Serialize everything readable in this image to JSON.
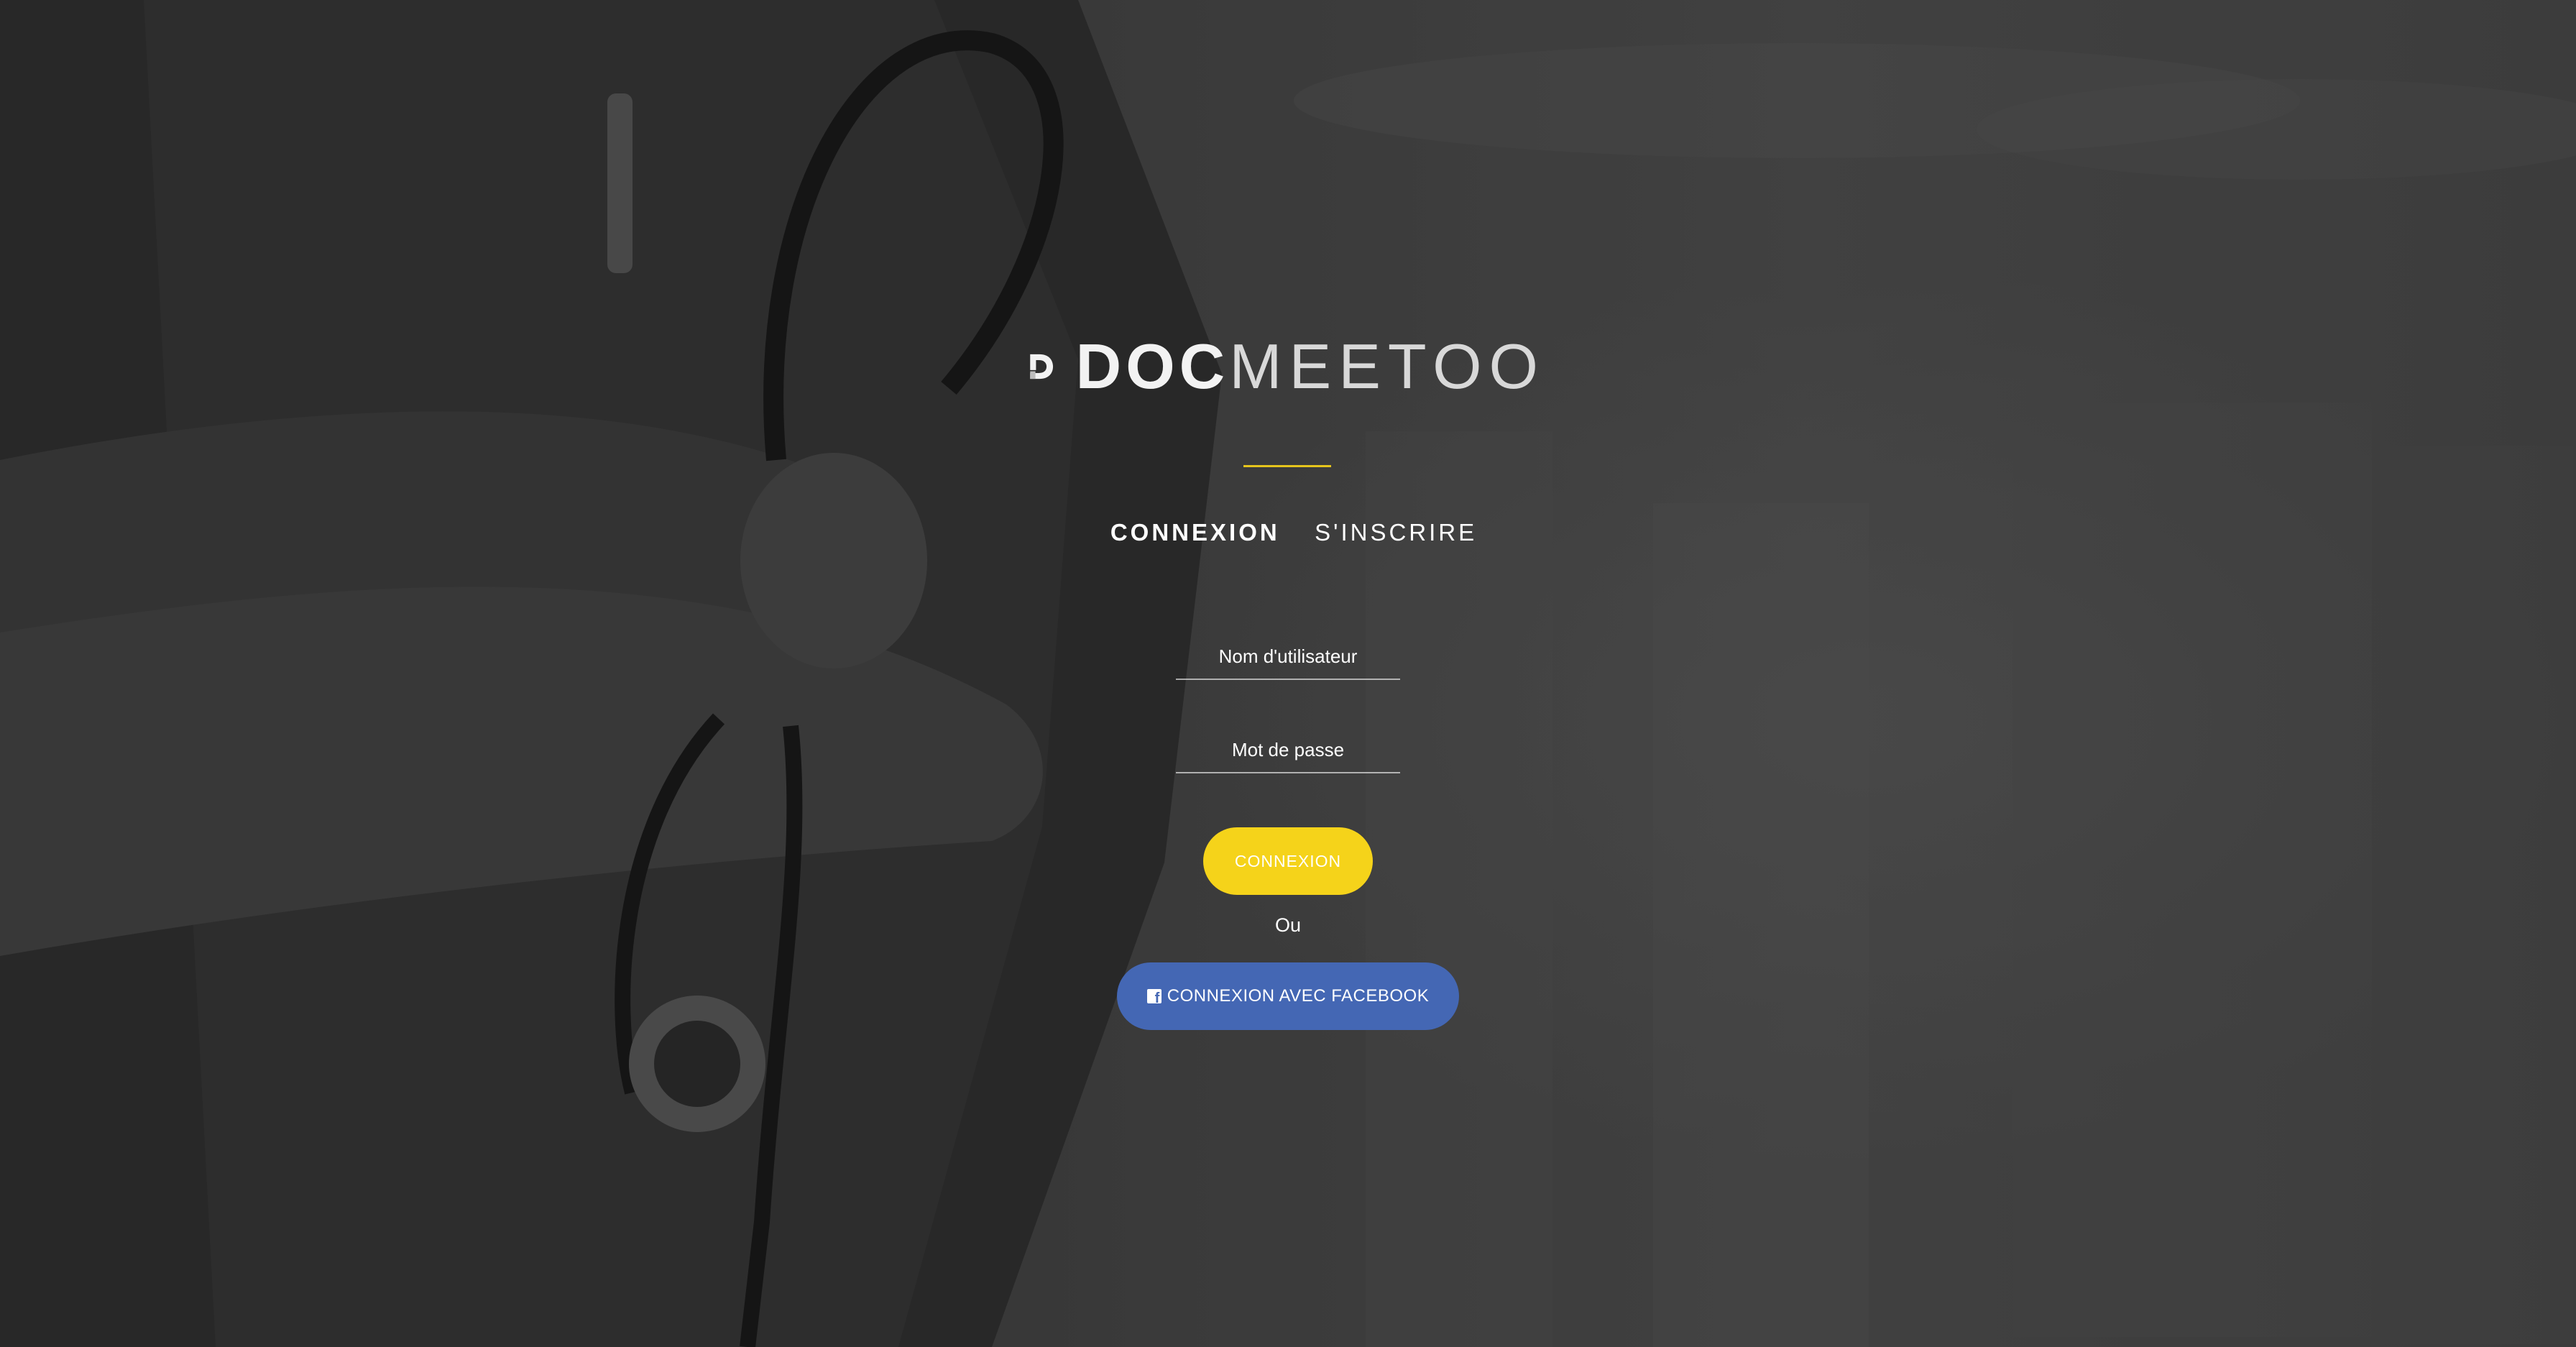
{
  "app": {
    "logo": {
      "bold_part": "DOC",
      "light_part": "MEETOO"
    }
  },
  "auth": {
    "tabs": [
      {
        "label": "CONNEXION",
        "active": true
      },
      {
        "label": "S'INSCRIRE",
        "active": false
      }
    ],
    "username": {
      "placeholder": "Nom d'utilisateur",
      "value": ""
    },
    "password": {
      "placeholder": "Mot de passe",
      "value": ""
    },
    "login_button": "CONNEXION",
    "or_text": "Ou",
    "facebook_button": "CONNEXION AVEC FACEBOOK"
  },
  "icons": {
    "logo_mark": "d-logo-icon",
    "facebook": "facebook-icon"
  },
  "colors": {
    "accent_yellow": "#f5d31a",
    "divider_yellow": "#e6c51c",
    "facebook_blue": "#4467b4",
    "text": "#ffffff"
  }
}
